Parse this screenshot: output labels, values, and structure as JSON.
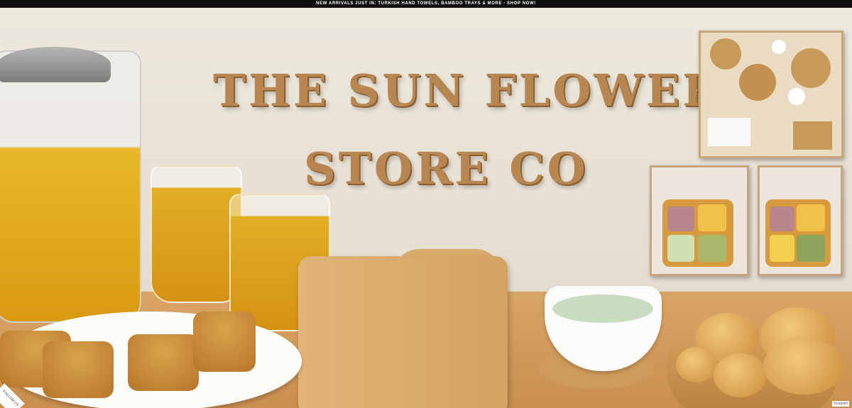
{
  "announcement": "NEW ARRIVALS JUST IN: TURKISH HAND TOWELS, BAMBOO TRAYS & MORE - SHOP NOW!",
  "hero": {
    "title_line1": "THE SUN FLOWER",
    "title_line2": "STORE CO"
  },
  "corner_badge": "FOLLOW US",
  "corner_mark": "Trustpilot"
}
